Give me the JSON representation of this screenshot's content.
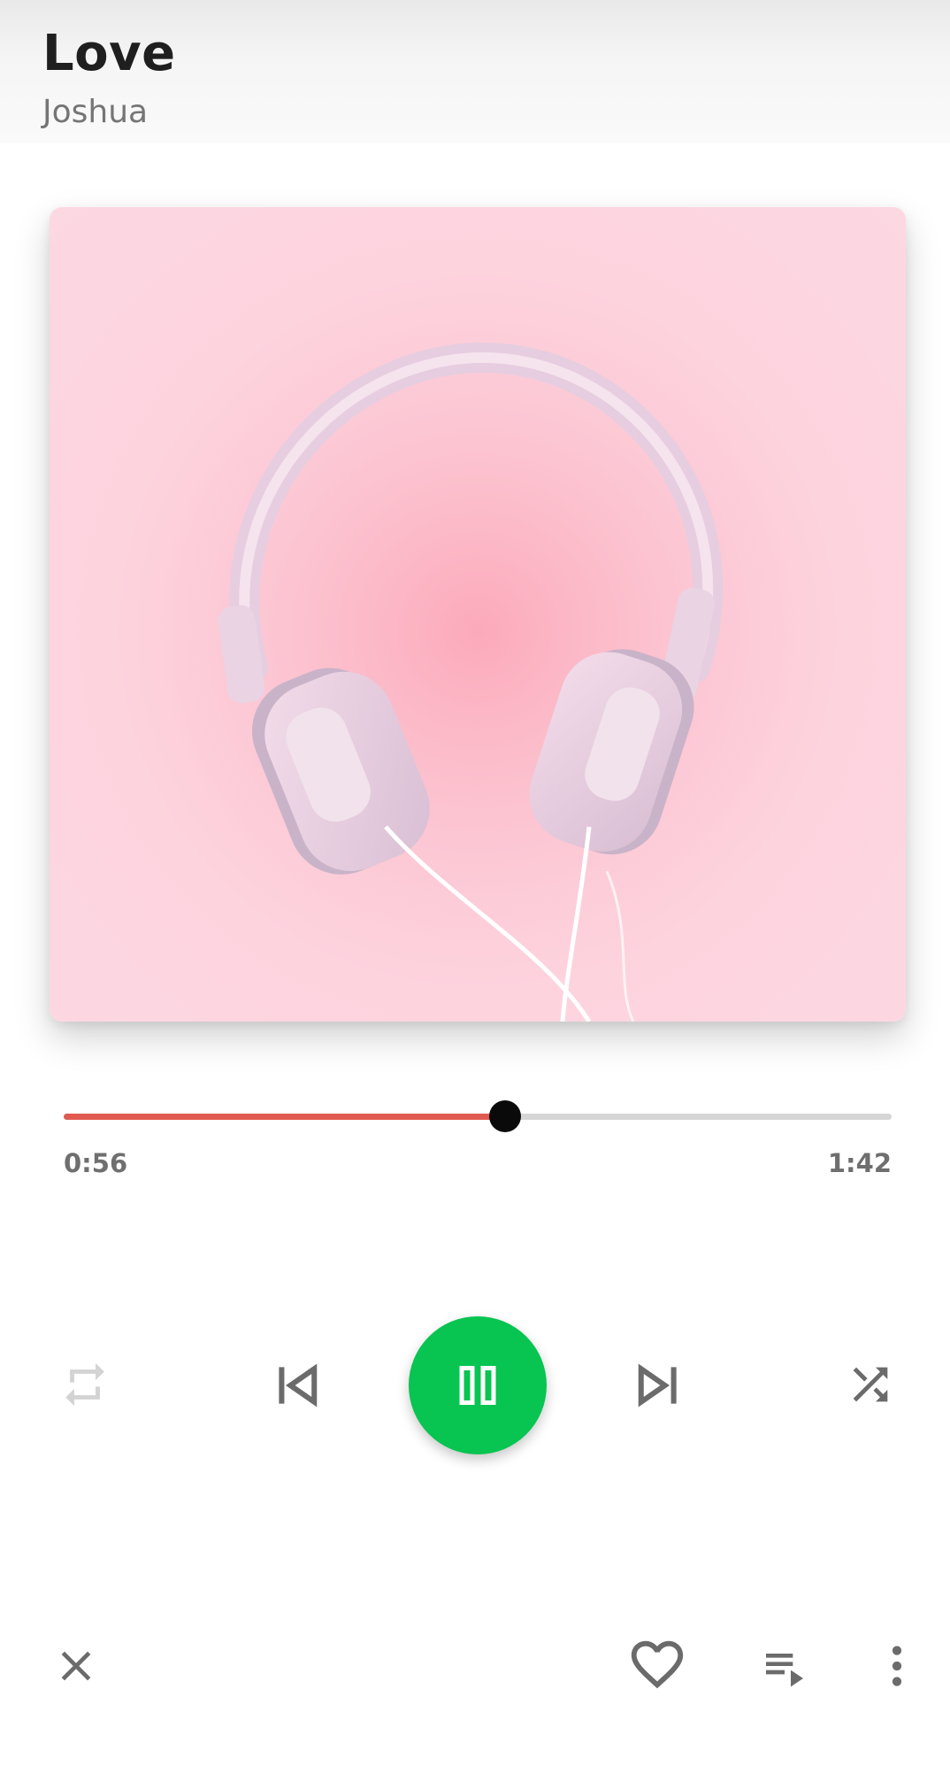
{
  "now_playing": {
    "title": "Love",
    "artist": "Joshua"
  },
  "album_art": {
    "icon": "headphones-artwork",
    "background_color": "#fcd0dc"
  },
  "progress": {
    "current_time": "0:56",
    "total_time": "1:42",
    "fraction": 0.533,
    "played_color": "#e05a50",
    "remaining_color": "#d6d6d6"
  },
  "controls": {
    "repeat": {
      "icon": "repeat-icon",
      "active": false
    },
    "previous": {
      "icon": "skip-previous-icon"
    },
    "play_pause": {
      "icon": "pause-icon",
      "state": "playing",
      "color": "#08c451"
    },
    "next": {
      "icon": "skip-next-icon"
    },
    "shuffle": {
      "icon": "shuffle-icon",
      "active": true
    }
  },
  "bottom_bar": {
    "close": {
      "icon": "close-icon"
    },
    "like": {
      "icon": "heart-outline-icon"
    },
    "queue": {
      "icon": "queue-music-icon"
    },
    "more": {
      "icon": "more-vert-icon"
    }
  }
}
